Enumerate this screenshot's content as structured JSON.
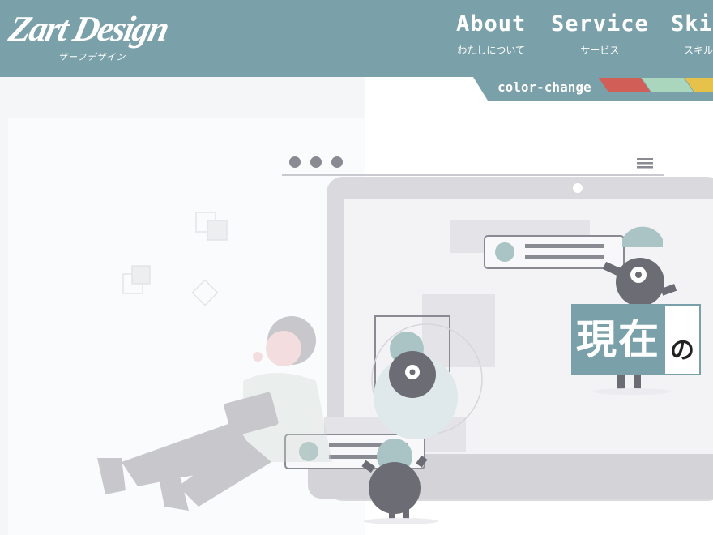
{
  "logo": {
    "main": "Zart Design",
    "sub": "ザーフデザイン"
  },
  "nav": [
    {
      "label": "About",
      "sub": "わたしについて"
    },
    {
      "label": "Service",
      "sub": "サービス"
    },
    {
      "label": "Skill",
      "sub": "スキル"
    }
  ],
  "color_change": {
    "label": "color-change",
    "swatches": [
      "#d25e58",
      "#a9d6bd",
      "#e6c24a"
    ]
  },
  "hero": {
    "main": "現在",
    "tail": "の"
  },
  "colors": {
    "accent": "#7aa0a9",
    "panel": "#ffffff"
  }
}
